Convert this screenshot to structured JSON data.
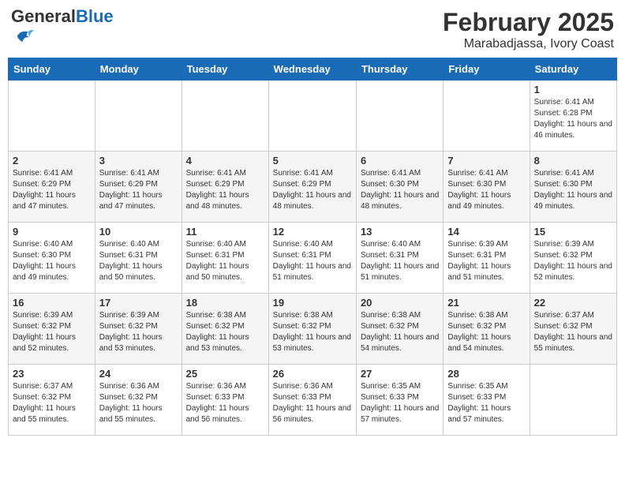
{
  "header": {
    "logo_general": "General",
    "logo_blue": "Blue",
    "month_year": "February 2025",
    "location": "Marabadjassa, Ivory Coast"
  },
  "weekdays": [
    "Sunday",
    "Monday",
    "Tuesday",
    "Wednesday",
    "Thursday",
    "Friday",
    "Saturday"
  ],
  "weeks": [
    [
      {
        "day": "",
        "info": ""
      },
      {
        "day": "",
        "info": ""
      },
      {
        "day": "",
        "info": ""
      },
      {
        "day": "",
        "info": ""
      },
      {
        "day": "",
        "info": ""
      },
      {
        "day": "",
        "info": ""
      },
      {
        "day": "1",
        "info": "Sunrise: 6:41 AM\nSunset: 6:28 PM\nDaylight: 11 hours and 46 minutes."
      }
    ],
    [
      {
        "day": "2",
        "info": "Sunrise: 6:41 AM\nSunset: 6:29 PM\nDaylight: 11 hours and 47 minutes."
      },
      {
        "day": "3",
        "info": "Sunrise: 6:41 AM\nSunset: 6:29 PM\nDaylight: 11 hours and 47 minutes."
      },
      {
        "day": "4",
        "info": "Sunrise: 6:41 AM\nSunset: 6:29 PM\nDaylight: 11 hours and 48 minutes."
      },
      {
        "day": "5",
        "info": "Sunrise: 6:41 AM\nSunset: 6:29 PM\nDaylight: 11 hours and 48 minutes."
      },
      {
        "day": "6",
        "info": "Sunrise: 6:41 AM\nSunset: 6:30 PM\nDaylight: 11 hours and 48 minutes."
      },
      {
        "day": "7",
        "info": "Sunrise: 6:41 AM\nSunset: 6:30 PM\nDaylight: 11 hours and 49 minutes."
      },
      {
        "day": "8",
        "info": "Sunrise: 6:41 AM\nSunset: 6:30 PM\nDaylight: 11 hours and 49 minutes."
      }
    ],
    [
      {
        "day": "9",
        "info": "Sunrise: 6:40 AM\nSunset: 6:30 PM\nDaylight: 11 hours and 49 minutes."
      },
      {
        "day": "10",
        "info": "Sunrise: 6:40 AM\nSunset: 6:31 PM\nDaylight: 11 hours and 50 minutes."
      },
      {
        "day": "11",
        "info": "Sunrise: 6:40 AM\nSunset: 6:31 PM\nDaylight: 11 hours and 50 minutes."
      },
      {
        "day": "12",
        "info": "Sunrise: 6:40 AM\nSunset: 6:31 PM\nDaylight: 11 hours and 51 minutes."
      },
      {
        "day": "13",
        "info": "Sunrise: 6:40 AM\nSunset: 6:31 PM\nDaylight: 11 hours and 51 minutes."
      },
      {
        "day": "14",
        "info": "Sunrise: 6:39 AM\nSunset: 6:31 PM\nDaylight: 11 hours and 51 minutes."
      },
      {
        "day": "15",
        "info": "Sunrise: 6:39 AM\nSunset: 6:32 PM\nDaylight: 11 hours and 52 minutes."
      }
    ],
    [
      {
        "day": "16",
        "info": "Sunrise: 6:39 AM\nSunset: 6:32 PM\nDaylight: 11 hours and 52 minutes."
      },
      {
        "day": "17",
        "info": "Sunrise: 6:39 AM\nSunset: 6:32 PM\nDaylight: 11 hours and 53 minutes."
      },
      {
        "day": "18",
        "info": "Sunrise: 6:38 AM\nSunset: 6:32 PM\nDaylight: 11 hours and 53 minutes."
      },
      {
        "day": "19",
        "info": "Sunrise: 6:38 AM\nSunset: 6:32 PM\nDaylight: 11 hours and 53 minutes."
      },
      {
        "day": "20",
        "info": "Sunrise: 6:38 AM\nSunset: 6:32 PM\nDaylight: 11 hours and 54 minutes."
      },
      {
        "day": "21",
        "info": "Sunrise: 6:38 AM\nSunset: 6:32 PM\nDaylight: 11 hours and 54 minutes."
      },
      {
        "day": "22",
        "info": "Sunrise: 6:37 AM\nSunset: 6:32 PM\nDaylight: 11 hours and 55 minutes."
      }
    ],
    [
      {
        "day": "23",
        "info": "Sunrise: 6:37 AM\nSunset: 6:32 PM\nDaylight: 11 hours and 55 minutes."
      },
      {
        "day": "24",
        "info": "Sunrise: 6:36 AM\nSunset: 6:32 PM\nDaylight: 11 hours and 55 minutes."
      },
      {
        "day": "25",
        "info": "Sunrise: 6:36 AM\nSunset: 6:33 PM\nDaylight: 11 hours and 56 minutes."
      },
      {
        "day": "26",
        "info": "Sunrise: 6:36 AM\nSunset: 6:33 PM\nDaylight: 11 hours and 56 minutes."
      },
      {
        "day": "27",
        "info": "Sunrise: 6:35 AM\nSunset: 6:33 PM\nDaylight: 11 hours and 57 minutes."
      },
      {
        "day": "28",
        "info": "Sunrise: 6:35 AM\nSunset: 6:33 PM\nDaylight: 11 hours and 57 minutes."
      },
      {
        "day": "",
        "info": ""
      }
    ]
  ]
}
